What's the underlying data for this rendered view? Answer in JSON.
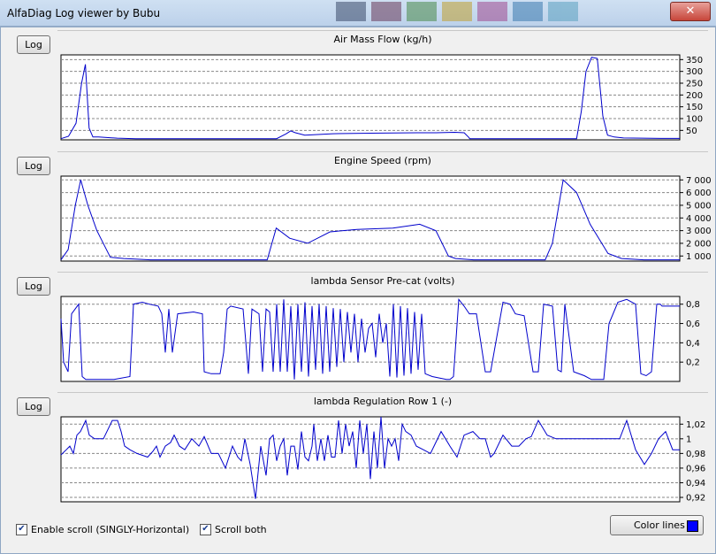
{
  "window": {
    "title": "AlfaDiag Log viewer by Bubu",
    "close_label": "✕"
  },
  "log_button_label": "Log",
  "charts": [
    {
      "title": "Air Mass Flow (kg/h)",
      "y_ticks": [
        "350",
        "300",
        "250",
        "200",
        "150",
        "100",
        "50"
      ],
      "y_tick_values": [
        350,
        300,
        250,
        200,
        150,
        100,
        50
      ],
      "ylim": [
        10,
        370
      ],
      "x": [
        0,
        8,
        16,
        22,
        26,
        30,
        34,
        40,
        60,
        80,
        120,
        230,
        240,
        245,
        250,
        260,
        290,
        330,
        380,
        400,
        420,
        430,
        435,
        436,
        440,
        550,
        555,
        560,
        566,
        572,
        578,
        583,
        590,
        600,
        620,
        640,
        660
      ],
      "y": [
        15,
        25,
        80,
        250,
        330,
        60,
        22,
        22,
        17,
        15,
        15,
        15,
        35,
        48,
        40,
        30,
        36,
        38,
        40,
        40,
        42,
        40,
        20,
        15,
        15,
        15,
        130,
        300,
        360,
        355,
        110,
        30,
        22,
        18,
        17,
        16,
        16
      ]
    },
    {
      "title": "Engine Speed (rpm)",
      "y_ticks": [
        "7 000",
        "6 000",
        "5 000",
        "4 000",
        "3 000",
        "2 000",
        "1 000"
      ],
      "y_tick_values": [
        7000,
        6000,
        5000,
        4000,
        3000,
        2000,
        1000
      ],
      "ylim": [
        600,
        7300
      ],
      "x": [
        0,
        8,
        16,
        22,
        30,
        40,
        55,
        70,
        100,
        230,
        240,
        255,
        275,
        300,
        330,
        370,
        400,
        418,
        432,
        440,
        460,
        540,
        548,
        560,
        575,
        590,
        610,
        625,
        650,
        690
      ],
      "y": [
        700,
        1500,
        5000,
        7000,
        5000,
        3000,
        900,
        800,
        700,
        700,
        3200,
        2400,
        2000,
        2900,
        3100,
        3200,
        3500,
        3000,
        1000,
        800,
        700,
        700,
        2000,
        7000,
        6000,
        3500,
        1200,
        800,
        700,
        700
      ]
    },
    {
      "title": "lambda Sensor Pre-cat (volts)",
      "y_ticks": [
        "0,8",
        "0,6",
        "0,4",
        "0,2"
      ],
      "y_tick_values": [
        0.8,
        0.6,
        0.4,
        0.2
      ],
      "ylim": [
        0.0,
        0.88
      ],
      "x": [
        0,
        3,
        8,
        12,
        16,
        20,
        24,
        28,
        32,
        40,
        60,
        78,
        82,
        92,
        100,
        110,
        114,
        118,
        122,
        126,
        132,
        150,
        160,
        162,
        170,
        180,
        184,
        188,
        192,
        206,
        212,
        216,
        224,
        228,
        232,
        236,
        240,
        244,
        248,
        252,
        256,
        260,
        264,
        268,
        272,
        276,
        280,
        284,
        288,
        292,
        296,
        300,
        304,
        308,
        312,
        316,
        320,
        324,
        328,
        332,
        336,
        340,
        344,
        348,
        352,
        356,
        360,
        364,
        368,
        372,
        376,
        380,
        384,
        388,
        392,
        396,
        400,
        404,
        408,
        412,
        420,
        436,
        440,
        444,
        450,
        456,
        462,
        470,
        480,
        486,
        500,
        508,
        514,
        524,
        534,
        540,
        546,
        556,
        562,
        566,
        570,
        580,
        592,
        600,
        608,
        614,
        620,
        630,
        640,
        650,
        656,
        662,
        668,
        674,
        678,
        680,
        690,
        700
      ],
      "y": [
        0.65,
        0.2,
        0.1,
        0.7,
        0.75,
        0.8,
        0.05,
        0.02,
        0.02,
        0.02,
        0.02,
        0.05,
        0.8,
        0.82,
        0.8,
        0.78,
        0.7,
        0.3,
        0.75,
        0.3,
        0.7,
        0.72,
        0.7,
        0.1,
        0.08,
        0.08,
        0.3,
        0.75,
        0.78,
        0.75,
        0.08,
        0.75,
        0.7,
        0.1,
        0.75,
        0.72,
        0.1,
        0.8,
        0.1,
        0.85,
        0.1,
        0.78,
        0.02,
        0.8,
        0.1,
        0.82,
        0.05,
        0.78,
        0.12,
        0.8,
        0.08,
        0.78,
        0.1,
        0.76,
        0.15,
        0.75,
        0.2,
        0.72,
        0.3,
        0.7,
        0.2,
        0.65,
        0.3,
        0.55,
        0.6,
        0.25,
        0.7,
        0.4,
        0.6,
        0.05,
        0.8,
        0.04,
        0.78,
        0.06,
        0.76,
        0.08,
        0.72,
        0.12,
        0.7,
        0.08,
        0.05,
        0.02,
        0.02,
        0.05,
        0.85,
        0.78,
        0.7,
        0.7,
        0.1,
        0.1,
        0.82,
        0.8,
        0.7,
        0.68,
        0.1,
        0.1,
        0.8,
        0.78,
        0.12,
        0.1,
        0.8,
        0.1,
        0.06,
        0.02,
        0.02,
        0.02,
        0.6,
        0.82,
        0.85,
        0.8,
        0.08,
        0.06,
        0.1,
        0.8,
        0.8,
        0.78,
        0.78,
        0.78
      ],
      "x_max": 700
    },
    {
      "title": "lambda Regulation Row 1 (-)",
      "y_ticks": [
        "1,02",
        "1",
        "0,98",
        "0,96",
        "0,94",
        "0,92"
      ],
      "y_tick_values": [
        1.02,
        1.0,
        0.98,
        0.96,
        0.94,
        0.92
      ],
      "ylim": [
        0.914,
        1.03
      ],
      "x": [
        0,
        6,
        10,
        14,
        18,
        22,
        28,
        32,
        38,
        48,
        58,
        64,
        68,
        72,
        78,
        86,
        98,
        104,
        108,
        112,
        118,
        124,
        128,
        134,
        140,
        148,
        156,
        162,
        170,
        178,
        186,
        194,
        200,
        204,
        208,
        214,
        220,
        226,
        232,
        236,
        240,
        244,
        248,
        252,
        256,
        260,
        264,
        268,
        272,
        276,
        280,
        284,
        286,
        290,
        294,
        298,
        302,
        306,
        310,
        314,
        318,
        322,
        326,
        330,
        334,
        338,
        342,
        346,
        350,
        354,
        358,
        362,
        366,
        370,
        374,
        378,
        382,
        386,
        390,
        396,
        402,
        410,
        418,
        430,
        440,
        448,
        456,
        466,
        474,
        480,
        486,
        490,
        500,
        510,
        518,
        526,
        532,
        540,
        550,
        560,
        568,
        576,
        584,
        592,
        600,
        608,
        616,
        624,
        632,
        640,
        650,
        660,
        668,
        676,
        684,
        692,
        700
      ],
      "y": [
        0.978,
        0.985,
        0.99,
        0.98,
        1.005,
        1.01,
        1.025,
        1.005,
        1.0,
        1.0,
        1.025,
        1.025,
        1.01,
        0.99,
        0.985,
        0.98,
        0.975,
        0.983,
        0.99,
        0.975,
        0.99,
        0.995,
        1.005,
        0.99,
        0.985,
        1.0,
        0.99,
        1.003,
        0.98,
        0.98,
        0.96,
        0.99,
        0.975,
        0.97,
        1.0,
        0.965,
        0.918,
        0.99,
        0.95,
        1.0,
        1.005,
        0.97,
        0.99,
        1.0,
        0.95,
        0.99,
        0.99,
        0.958,
        1.01,
        0.975,
        0.97,
        0.99,
        1.02,
        0.97,
        1.0,
        0.97,
        1.005,
        0.975,
        0.975,
        1.025,
        0.98,
        1.02,
        0.99,
        1.01,
        0.96,
        1.025,
        0.98,
        1.02,
        0.945,
        1.01,
        0.96,
        1.03,
        0.96,
        1.0,
        0.99,
        1.0,
        0.97,
        1.02,
        1.01,
        1.005,
        0.99,
        0.985,
        0.98,
        1.01,
        0.99,
        0.975,
        1.005,
        1.01,
        1.0,
        1.0,
        0.975,
        0.98,
        1.005,
        0.99,
        0.99,
        1.0,
        1.003,
        1.025,
        1.005,
        1.0,
        1.0,
        1.0,
        1.0,
        1.0,
        1.0,
        1.0,
        1.0,
        1.0,
        1.0,
        1.025,
        0.985,
        0.965,
        0.98,
        1.0,
        1.01,
        0.985,
        0.985
      ],
      "x_max": 700
    }
  ],
  "controls": {
    "enable_scroll_label": "Enable scroll (SINGLY-Horizontal)",
    "enable_scroll_checked": true,
    "scroll_both_label": "Scroll both",
    "scroll_both_checked": true,
    "color_lines_label": "Color lines",
    "line_color": "#0000cc",
    "swatch_color": "#0000ff"
  }
}
